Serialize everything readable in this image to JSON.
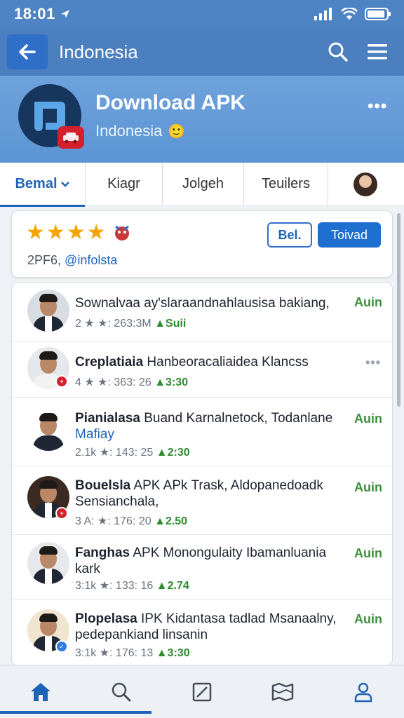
{
  "status": {
    "time": "18:01"
  },
  "app_bar": {
    "title": "Indonesia"
  },
  "header": {
    "title": "Download APK",
    "subtitle": "Indonesia",
    "subtitle_emoji": "🙂"
  },
  "tabs": [
    {
      "label": "Bemal",
      "active": true
    },
    {
      "label": "Kiagr"
    },
    {
      "label": "Jolgeh"
    },
    {
      "label": "Teuilers"
    }
  ],
  "rating": {
    "stars": 4,
    "meta_count": "2PF6,",
    "meta_handle": "@infolsta",
    "button_outline": "Bel.",
    "button_primary": "Toivad"
  },
  "list": [
    {
      "title_bold": "",
      "title": "Sownalvaa ay'slaraandnahlausisa bakiang,",
      "title_sub": "",
      "stats": "2 ★ ★: 263:3M",
      "price": "Suii",
      "action": "Auin",
      "badge": "",
      "badge_color": ""
    },
    {
      "title_bold": "Creplatiaia",
      "title": " Hanbeoracaliaidea Klancss",
      "title_sub": "",
      "stats": "4 ★ ★: 363: 26",
      "price": "3:30",
      "action": "",
      "dots": "•••",
      "badge": "+",
      "badge_color": "#d3202c"
    },
    {
      "title_bold": "Pianialasa",
      "title": " Buand Karnalnetock, Todanlane",
      "title_sub": "Mafiay",
      "stats": "2.1k ★: 143: 25",
      "price": "2:30",
      "action": "Auin",
      "badge": "",
      "badge_color": ""
    },
    {
      "title_bold": "Bouelsla",
      "title": " APK APk Trask, Aldopanedoadk Sensianchala,",
      "title_sub": "",
      "stats": "3 A: ★: 176: 20",
      "price": "2.50",
      "action": "Auin",
      "badge": "+",
      "badge_color": "#d3202c"
    },
    {
      "title_bold": "Fanghas",
      "title": " APK Monongulaity Ibamanluania kark",
      "title_sub": "",
      "stats": "3:1k ★: 133: 16",
      "price": "2.74",
      "action": "Auin",
      "badge": "",
      "badge_color": ""
    },
    {
      "title_bold": "Plopelasa",
      "title": " IPK Kidantasa tadlad Msanaalny, pedepankiand linsanin",
      "title_sub": "",
      "stats": "3:1k ★: 176: 13",
      "price": "3:30",
      "action": "Auin",
      "badge": "✓",
      "badge_color": "#2f7de0"
    }
  ],
  "colors": {
    "accent": "#1f63b8",
    "header": "#4b7fc0",
    "price": "#2e8b2e",
    "star": "#f5a400"
  },
  "icons": [
    "arrow-left-icon",
    "search-icon",
    "menu-icon",
    "home-icon",
    "edit-icon",
    "map-icon",
    "profile-icon"
  ]
}
